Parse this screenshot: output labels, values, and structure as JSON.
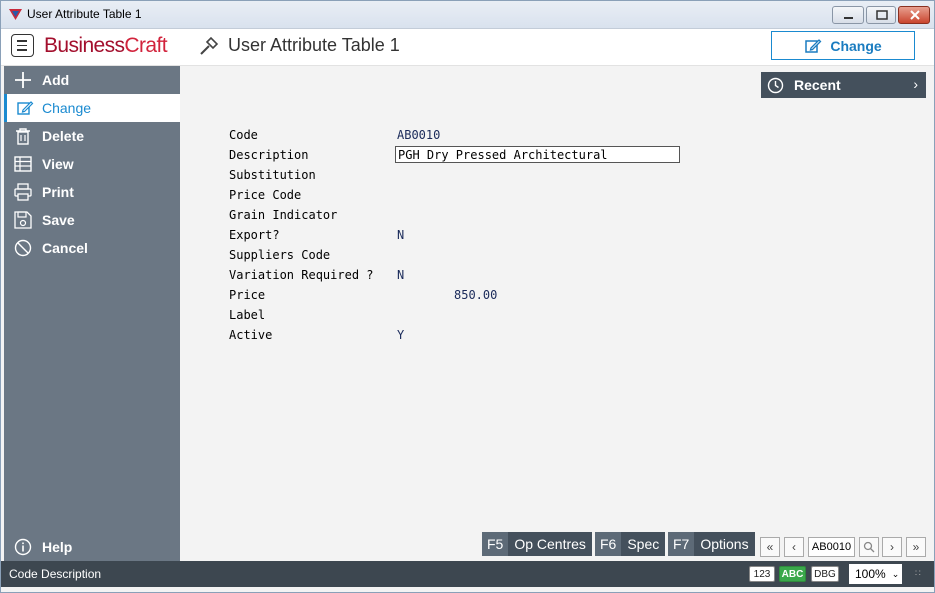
{
  "window": {
    "title": "User Attribute Table 1"
  },
  "header": {
    "logo_part1": "Business",
    "logo_part2": "Craft",
    "page_title": "User Attribute Table 1",
    "change_button": "Change"
  },
  "sidebar": {
    "items": [
      {
        "label": "Add",
        "icon": "plus-icon"
      },
      {
        "label": "Change",
        "icon": "edit-icon"
      },
      {
        "label": "Delete",
        "icon": "trash-icon"
      },
      {
        "label": "View",
        "icon": "table-icon"
      },
      {
        "label": "Print",
        "icon": "printer-icon"
      },
      {
        "label": "Save",
        "icon": "save-icon"
      },
      {
        "label": "Cancel",
        "icon": "cancel-icon"
      }
    ],
    "help": "Help"
  },
  "recent": {
    "label": "Recent"
  },
  "form": {
    "fields": [
      {
        "label": "Code",
        "value": "AB0010"
      },
      {
        "label": "Description",
        "value": "PGH Dry Pressed Architectural"
      },
      {
        "label": "Substitution",
        "value": ""
      },
      {
        "label": "Price Code",
        "value": ""
      },
      {
        "label": "Grain Indicator",
        "value": ""
      },
      {
        "label": "Export?",
        "value": "N"
      },
      {
        "label": "Suppliers Code",
        "value": ""
      },
      {
        "label": "Variation Required ?",
        "value": "N"
      },
      {
        "label": "Price",
        "value": "850.00"
      },
      {
        "label": "Label",
        "value": ""
      },
      {
        "label": "Active",
        "value": "Y"
      }
    ]
  },
  "function_keys": [
    {
      "key": "F5",
      "label": "Op Centres"
    },
    {
      "key": "F6",
      "label": "Spec"
    },
    {
      "key": "F7",
      "label": "Options"
    }
  ],
  "navigator": {
    "current_record": "AB0010"
  },
  "statusbar": {
    "text": "Code Description",
    "badges": [
      "123",
      "ABC",
      "DBG"
    ],
    "zoom": "100%"
  },
  "colors": {
    "accent": "#1a8ad0",
    "sidebar": "#6b7784",
    "brand": "#a30f2d"
  }
}
